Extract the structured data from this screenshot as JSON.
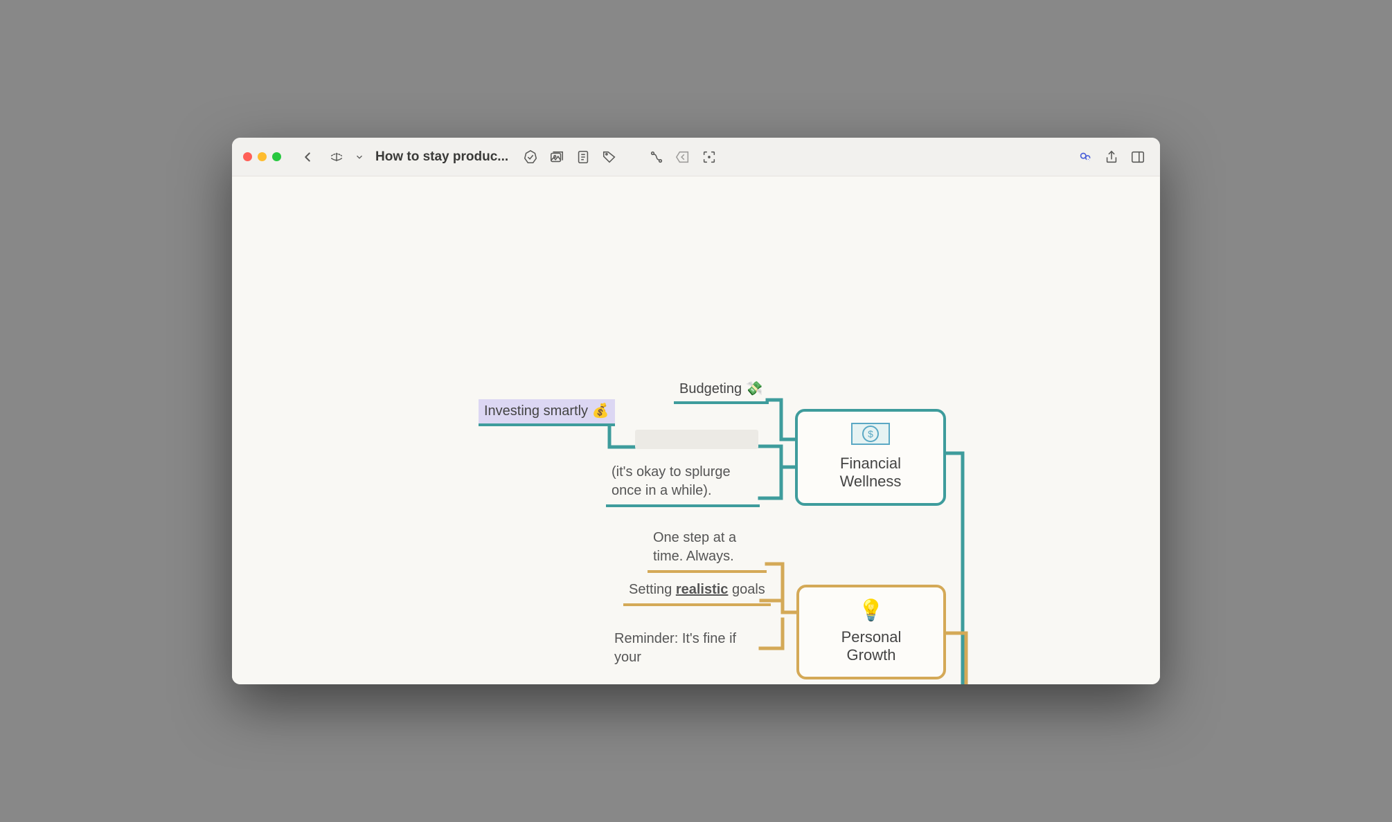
{
  "titlebar": {
    "doc_title": "How to stay produc..."
  },
  "mindmap": {
    "financial": {
      "title": "Financial Wellness",
      "children": {
        "budgeting": "Budgeting 💸",
        "investing": "Investing smartly 💰",
        "splurge": "(it's okay to splurge once in a while)."
      }
    },
    "growth": {
      "title": "Personal Growth",
      "children": {
        "onestep": "One step at a time. Always.",
        "goals_pre": "Setting ",
        "goals_bold": "realistic",
        "goals_post": " goals",
        "reminder": "Reminder: It's fine if your"
      }
    }
  },
  "colors": {
    "teal": "#3e9c9c",
    "gold": "#d4a957"
  }
}
